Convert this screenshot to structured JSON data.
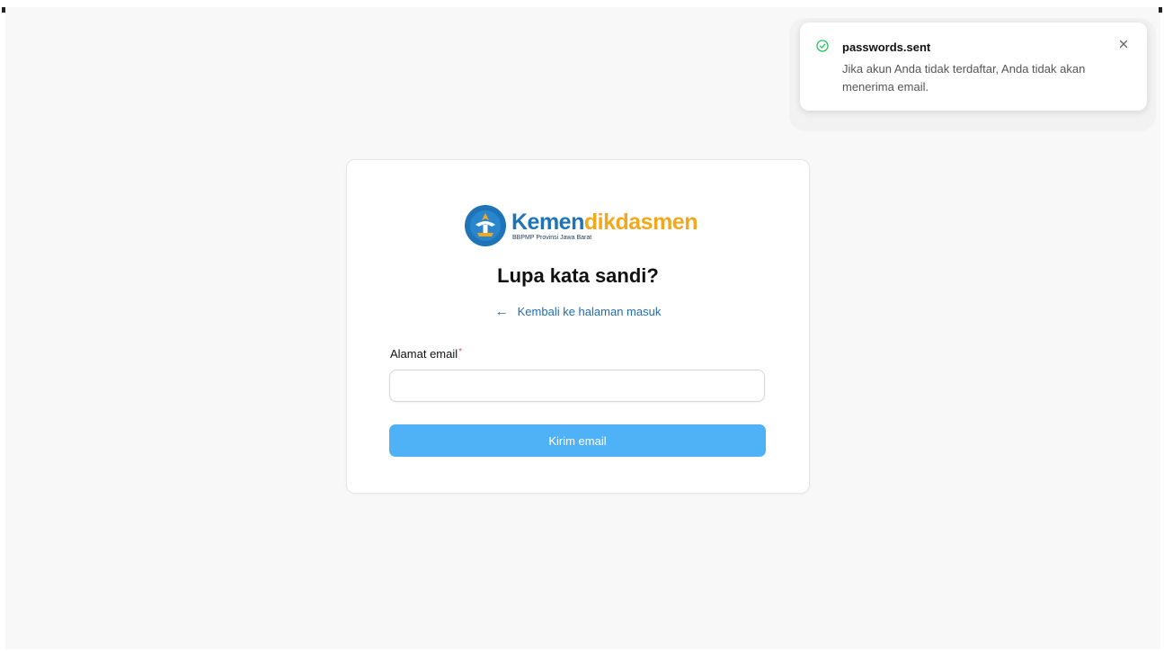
{
  "logo": {
    "word_part1": "Kemen",
    "word_part2": "dikdasmen",
    "subtitle": "BBPMP Provinsi Jawa Barat",
    "emblem_icon": "tut-wuri-handayani-emblem"
  },
  "form": {
    "title": "Lupa kata sandi?",
    "back_link": "Kembali ke halaman masuk",
    "back_icon": "arrow-left-icon",
    "email_label": "Alamat email",
    "required_marker": "*",
    "email_value": "",
    "submit_label": "Kirim email"
  },
  "toast": {
    "title": "passwords.sent",
    "message": "Jika akun Anda tidak terdaftar, Anda tidak akan menerima email.",
    "status_icon": "check-circle-icon",
    "close_icon": "close-icon"
  },
  "colors": {
    "page_bg": "#f8f8f8",
    "brand_blue": "#1f74b8",
    "brand_orange": "#f2a81d",
    "link": "#1f6db2",
    "button_bg": "#4fb2f7",
    "success": "#22c55e",
    "required": "#e5484d"
  }
}
